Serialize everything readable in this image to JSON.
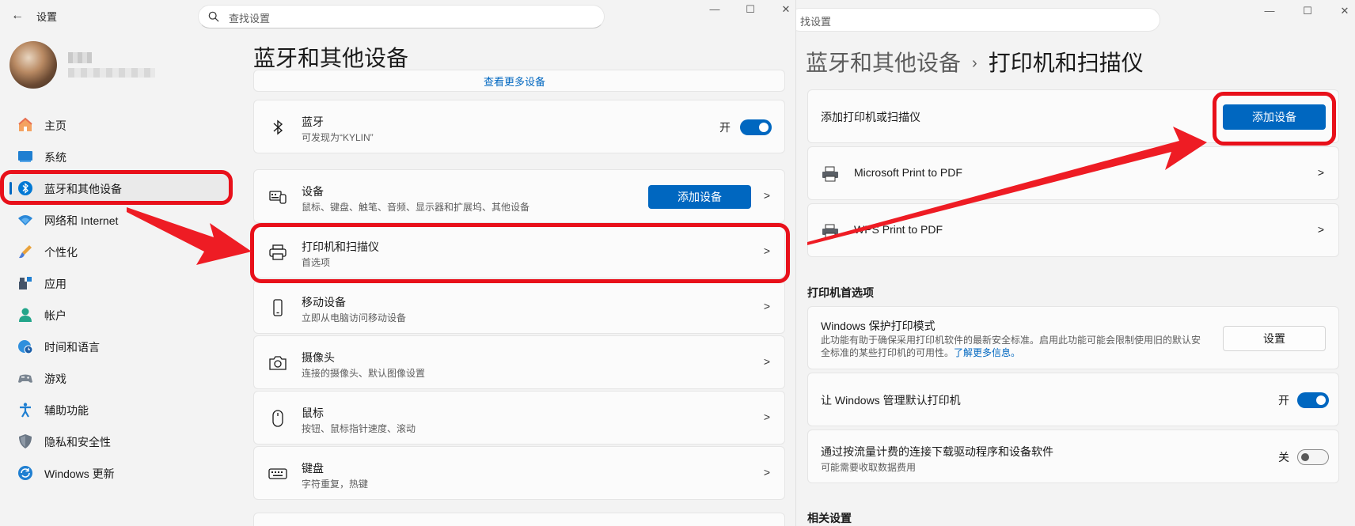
{
  "left": {
    "app_title": "设置",
    "search_placeholder": "查找设置",
    "page_title": "蓝牙和其他设备",
    "nav": [
      {
        "label": "主页",
        "icon": "home-icon"
      },
      {
        "label": "系统",
        "icon": "system-icon"
      },
      {
        "label": "蓝牙和其他设备",
        "icon": "bluetooth-icon",
        "active": true
      },
      {
        "label": "网络和 Internet",
        "icon": "wifi-icon"
      },
      {
        "label": "个性化",
        "icon": "brush-icon"
      },
      {
        "label": "应用",
        "icon": "apps-icon"
      },
      {
        "label": "帐户",
        "icon": "account-icon"
      },
      {
        "label": "时间和语言",
        "icon": "globe-clock-icon"
      },
      {
        "label": "游戏",
        "icon": "gamepad-icon"
      },
      {
        "label": "辅助功能",
        "icon": "accessibility-icon"
      },
      {
        "label": "隐私和安全性",
        "icon": "shield-icon"
      },
      {
        "label": "Windows 更新",
        "icon": "update-icon"
      }
    ],
    "top_link": "查看更多设备",
    "bluetooth": {
      "title": "蓝牙",
      "subtitle": "可发现为“KYLIN”",
      "state": "开"
    },
    "devices": {
      "title": "设备",
      "subtitle": "鼠标、键盘、触笔、音频、显示器和扩展坞、其他设备",
      "button": "添加设备"
    },
    "printers": {
      "title": "打印机和扫描仪",
      "subtitle": "首选项"
    },
    "mobile": {
      "title": "移动设备",
      "subtitle": "立即从电脑访问移动设备"
    },
    "camera": {
      "title": "摄像头",
      "subtitle": "连接的摄像头、默认图像设置"
    },
    "mouse": {
      "title": "鼠标",
      "subtitle": "按钮、鼠标指针速度、滚动"
    },
    "keyboard": {
      "title": "键盘",
      "subtitle": "字符重复，热键"
    }
  },
  "right": {
    "search_text": "找设置",
    "breadcrumb_parent": "蓝牙和其他设备",
    "breadcrumb_sep": "›",
    "breadcrumb_current": "打印机和扫描仪",
    "add_label": "添加打印机或扫描仪",
    "add_button": "添加设备",
    "printers": [
      "Microsoft Print to PDF",
      "WPS Print to PDF"
    ],
    "prefs_header": "打印机首选项",
    "protected_mode": {
      "title": "Windows 保护打印模式",
      "desc": "此功能有助于确保采用打印机软件的最新安全标准。启用此功能可能会限制使用旧的默认安全标准的某些打印机的可用性。",
      "link": "了解更多信息。",
      "button": "设置"
    },
    "manage_default": {
      "title": "让 Windows 管理默认打印机",
      "state": "开"
    },
    "metered": {
      "title": "通过按流量计费的连接下载驱动程序和设备软件",
      "subtitle": "可能需要收取数据费用",
      "state": "关"
    },
    "related_header": "相关设置"
  },
  "colors": {
    "accent": "#0067c0",
    "highlight": "#e8101a"
  }
}
